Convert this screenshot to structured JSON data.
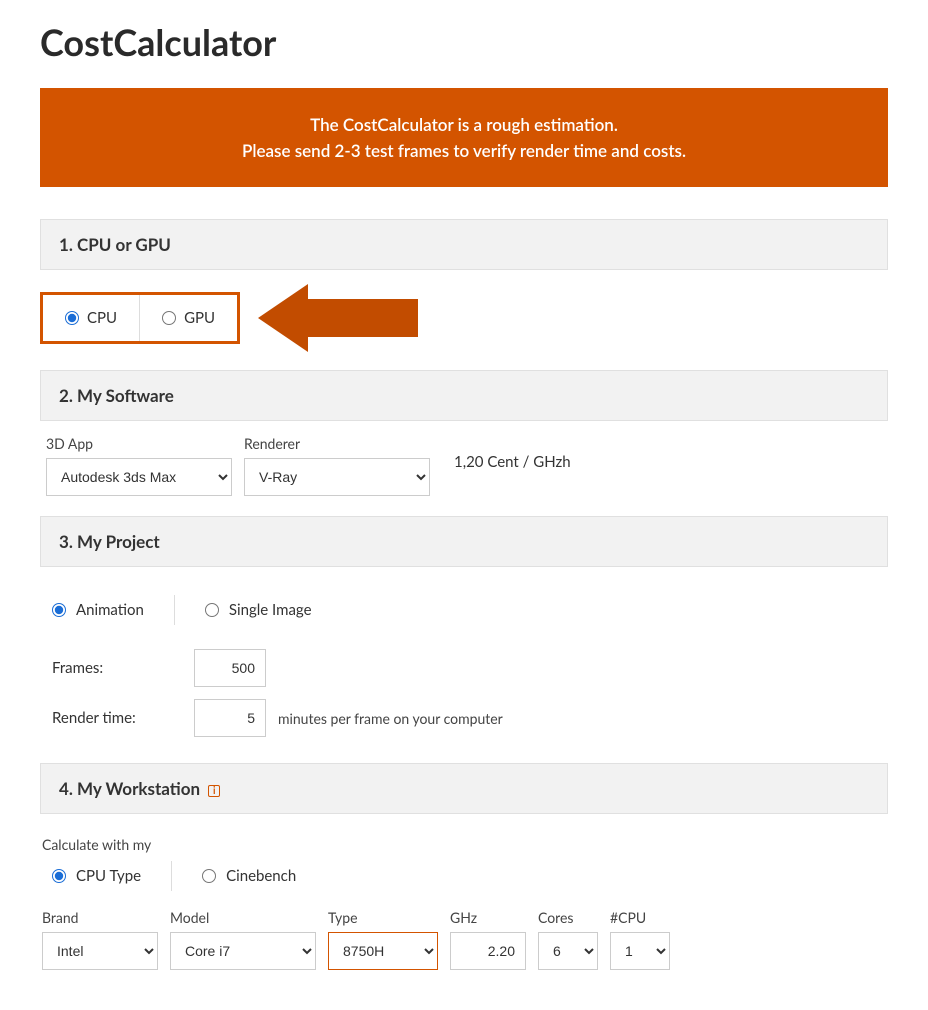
{
  "title": "CostCalculator",
  "banner": {
    "line1": "The CostCalculator is a rough estimation.",
    "line2": "Please send 2-3 test frames to verify render time and costs."
  },
  "section1": {
    "title": "1. CPU or GPU",
    "options": {
      "cpu": "CPU",
      "gpu": "GPU"
    }
  },
  "section2": {
    "title": "2. My Software",
    "app_label": "3D App",
    "app_selected": "Autodesk 3ds Max",
    "renderer_label": "Renderer",
    "renderer_selected": "V-Ray",
    "price": "1,20 Cent / GHzh"
  },
  "section3": {
    "title": "3. My Project",
    "animation": "Animation",
    "single_image": "Single Image",
    "frames_label": "Frames:",
    "frames_value": "500",
    "render_time_label": "Render time:",
    "render_time_value": "5",
    "render_time_hint": "minutes per frame on your computer"
  },
  "section4": {
    "title": "4. My Workstation",
    "calc_with_label": "Calculate with my",
    "cpu_type": "CPU Type",
    "cinebench": "Cinebench",
    "brand_label": "Brand",
    "brand_selected": "Intel",
    "model_label": "Model",
    "model_selected": "Core i7",
    "type_label": "Type",
    "type_selected": "8750H",
    "ghz_label": "GHz",
    "ghz_value": "2.20",
    "cores_label": "Cores",
    "cores_selected": "6",
    "ncpu_label": "#CPU",
    "ncpu_selected": "1"
  }
}
